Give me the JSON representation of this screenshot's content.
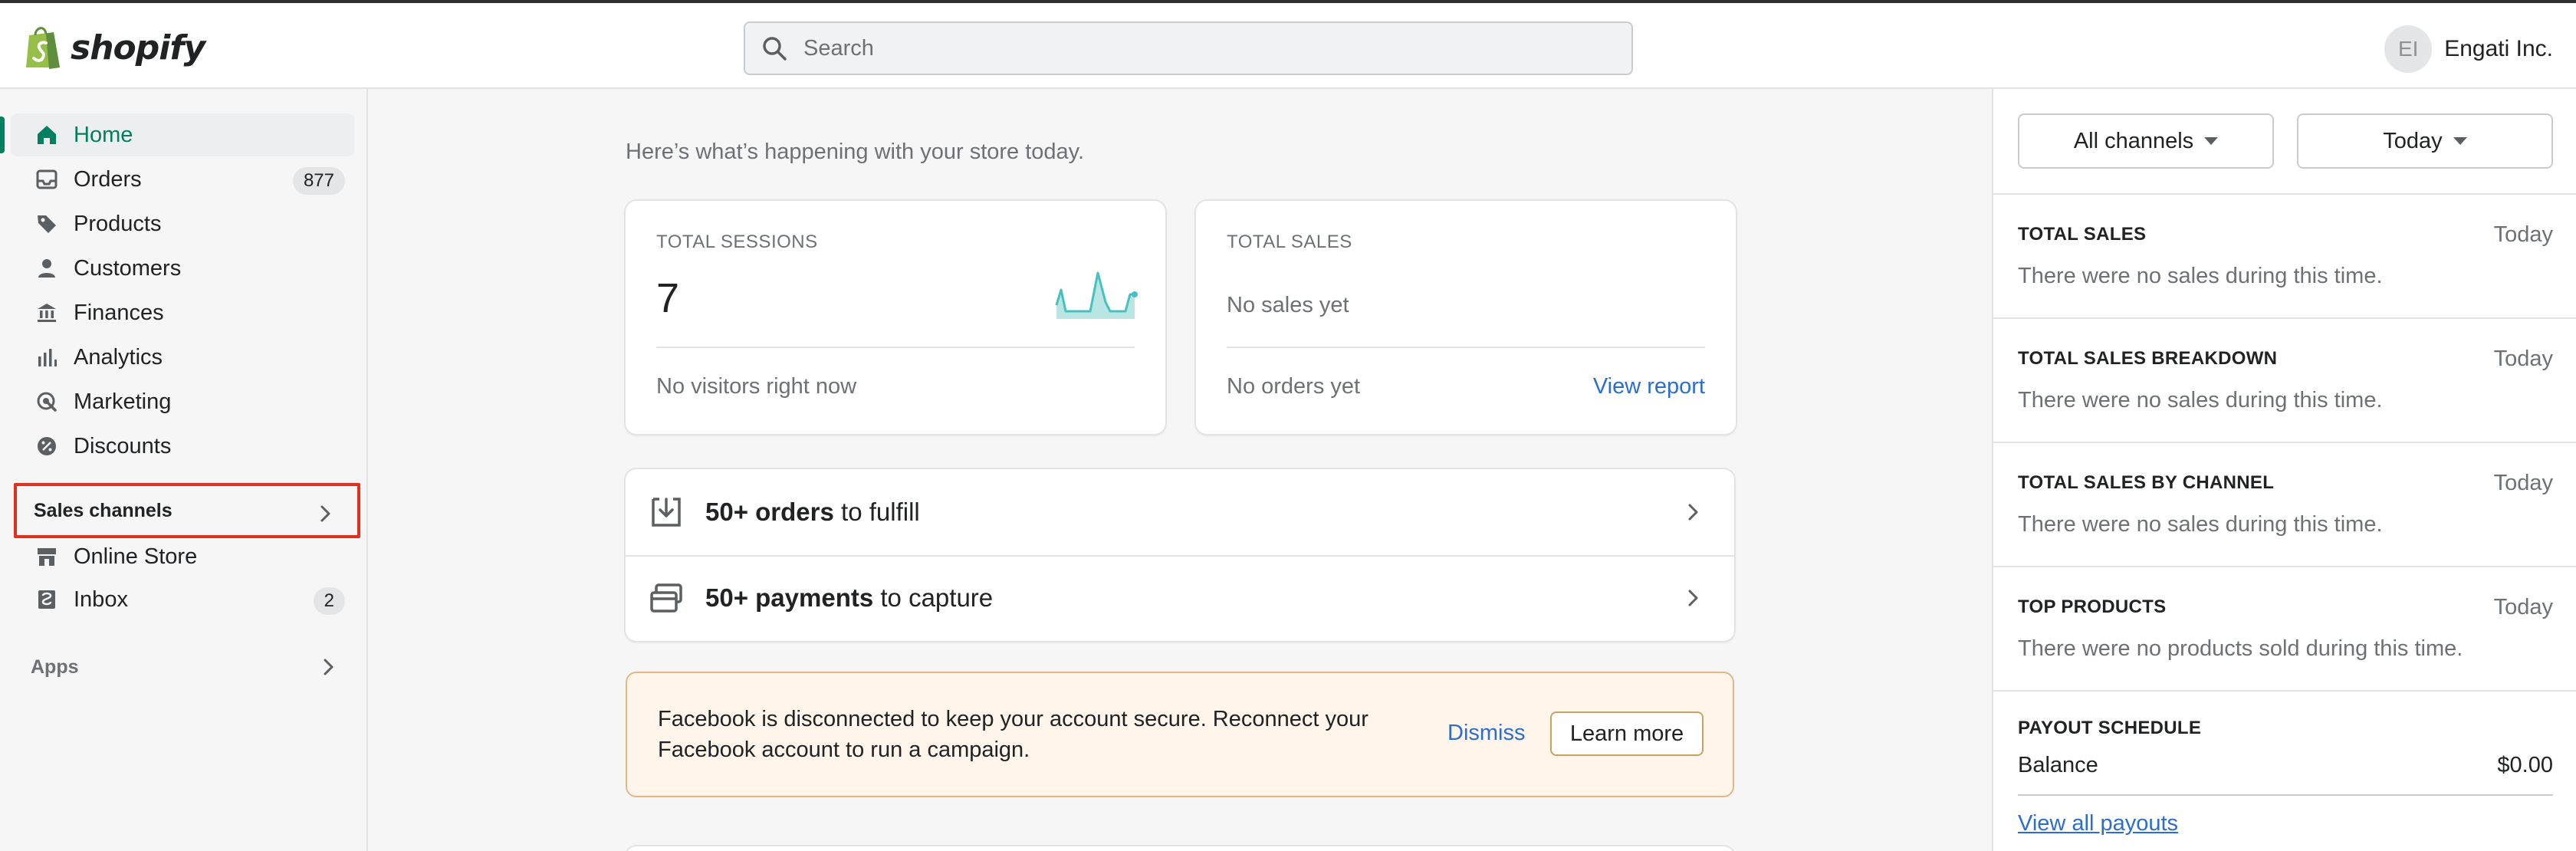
{
  "header": {
    "logo_text": "shopify",
    "search_placeholder": "Search",
    "user": {
      "initials": "EI",
      "name": "Engati Inc."
    }
  },
  "sidebar": {
    "items": [
      {
        "label": "Home",
        "icon": "home-icon",
        "active": true
      },
      {
        "label": "Orders",
        "icon": "orders-icon",
        "badge": "877"
      },
      {
        "label": "Products",
        "icon": "tag-icon"
      },
      {
        "label": "Customers",
        "icon": "person-icon"
      },
      {
        "label": "Finances",
        "icon": "bank-icon"
      },
      {
        "label": "Analytics",
        "icon": "bar-chart-icon"
      },
      {
        "label": "Marketing",
        "icon": "marketing-icon"
      },
      {
        "label": "Discounts",
        "icon": "discount-icon"
      }
    ],
    "sales_channels": {
      "label": "Sales channels",
      "items": [
        {
          "label": "Online Store",
          "icon": "store-icon"
        },
        {
          "label": "Inbox",
          "icon": "inbox-icon",
          "badge": "2"
        }
      ]
    },
    "apps_label": "Apps"
  },
  "main": {
    "greeting": "Here’s what’s happening with your store today.",
    "sessions_card": {
      "label": "TOTAL SESSIONS",
      "value": "7",
      "footer": "No visitors right now"
    },
    "sales_card": {
      "label": "TOTAL SALES",
      "value_text": "No sales yet",
      "footer": "No orders yet",
      "link": "View report"
    },
    "tasks": [
      {
        "bold": "50+ orders",
        "rest": " to fulfill",
        "icon": "fulfill-icon"
      },
      {
        "bold": "50+ payments",
        "rest": " to capture",
        "icon": "payment-card-icon"
      }
    ],
    "banner": {
      "text": "Facebook is disconnected to keep your account secure. Reconnect your Facebook account to run a campaign.",
      "dismiss": "Dismiss",
      "learn_more": "Learn more"
    }
  },
  "right_panel": {
    "channels_select": "All channels",
    "date_select": "Today",
    "sections": [
      {
        "title": "TOTAL SALES",
        "range": "Today",
        "message": "There were no sales during this time."
      },
      {
        "title": "TOTAL SALES BREAKDOWN",
        "range": "Today",
        "message": "There were no sales during this time."
      },
      {
        "title": "TOTAL SALES BY CHANNEL",
        "range": "Today",
        "message": "There were no sales during this time."
      },
      {
        "title": "TOP PRODUCTS",
        "range": "Today",
        "message": "There were no products sold during this time."
      }
    ],
    "payout": {
      "title": "PAYOUT SCHEDULE",
      "balance_label": "Balance",
      "balance_value": "$0.00",
      "link": "View all payouts"
    }
  },
  "colors": {
    "accent": "#008060",
    "link": "#2c6ecb",
    "highlight_border": "#e0301e",
    "sparkline": "#47c1bf"
  }
}
